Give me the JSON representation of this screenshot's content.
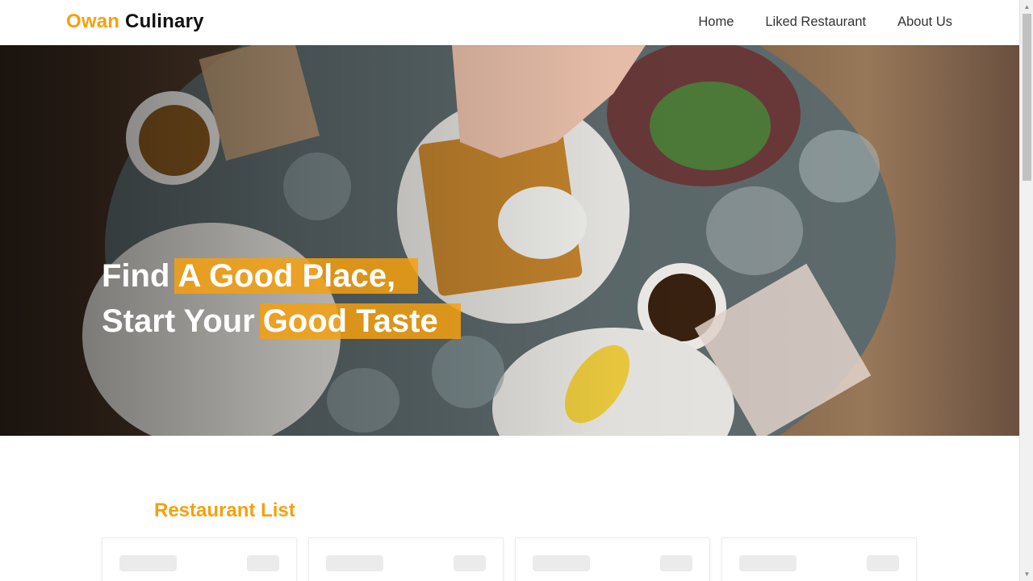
{
  "brand": {
    "first": "Owan",
    "second": "Culinary"
  },
  "nav": {
    "items": [
      "Home",
      "Liked Restaurant",
      "About Us"
    ]
  },
  "hero": {
    "line1_plain": "Find",
    "line1_highlight": "A Good Place,",
    "line2_plain": "Start Your",
    "line2_highlight": "Good Taste"
  },
  "restaurants": {
    "title": "Restaurant List",
    "loading_cards": 4
  },
  "colors": {
    "accent": "#f5a00f",
    "text_dark": "#111111"
  }
}
